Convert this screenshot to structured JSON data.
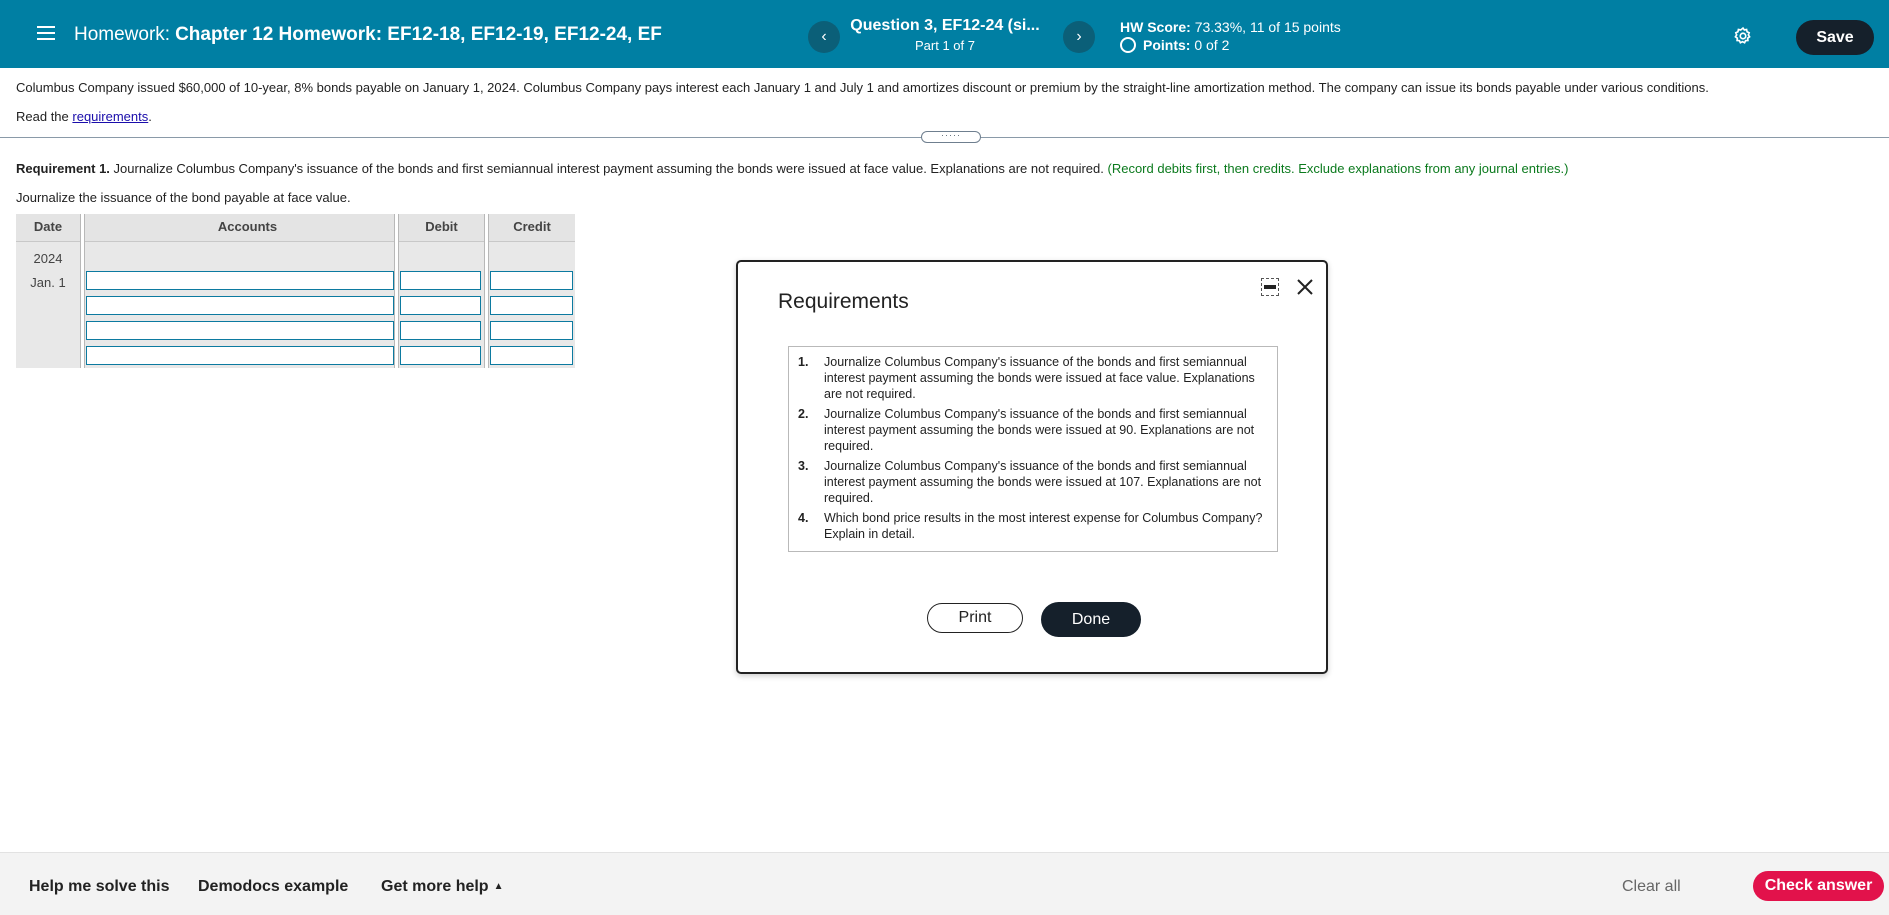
{
  "header": {
    "homework_label": "Homework:",
    "homework_name": "Chapter 12 Homework: EF12-18, EF12-19, EF12-24, EF",
    "prev_icon": "‹",
    "next_icon": "›",
    "question_title": "Question 3, EF12-24 (si...",
    "question_part": "Part 1 of 7",
    "hw_score_label": "HW Score:",
    "hw_score_value": "73.33%, 11 of 15 points",
    "points_label": "Points:",
    "points_value": "0 of 2",
    "save_label": "Save",
    "icons": [
      "menu-icon",
      "chevron-left-icon",
      "chevron-right-icon",
      "gear-icon"
    ],
    "accent_color": "#007fa3"
  },
  "problem": {
    "statement": "Columbus Company issued $60,000 of 10-year, 8% bonds payable on January 1, 2024. Columbus Company pays interest each January 1 and July 1 and amortizes discount or premium by the straight-line amortization method. The company can issue its bonds payable under various conditions.",
    "read_prefix": "Read the",
    "read_link": "requirements",
    "read_suffix": ".",
    "drag_handle": "·····"
  },
  "requirement1": {
    "label": "Requirement 1.",
    "text": "Journalize Columbus Company's issuance of the bonds and first semiannual interest payment assuming the bonds were issued at face value. Explanations are not required.",
    "instruction": "(Record debits first, then credits. Exclude explanations from any journal entries.)",
    "subtitle": "Journalize the issuance of the bond payable at face value."
  },
  "journal": {
    "headers": [
      "Date",
      "Accounts",
      "Debit",
      "Credit"
    ],
    "year": "2024",
    "date": "Jan. 1",
    "rows": [
      {
        "account": "",
        "debit": "",
        "credit": ""
      },
      {
        "account": "",
        "debit": "",
        "credit": ""
      },
      {
        "account": "",
        "debit": "",
        "credit": ""
      },
      {
        "account": "",
        "debit": "",
        "credit": ""
      }
    ]
  },
  "modal": {
    "title": "Requirements",
    "items": [
      {
        "num": "1.",
        "text": "Journalize Columbus Company's issuance of the bonds and first semiannual interest payment assuming the bonds were issued at face value. Explanations are not required."
      },
      {
        "num": "2.",
        "text": "Journalize Columbus Company's issuance of the bonds and first semiannual interest payment assuming the bonds were issued at 90. Explanations are not required."
      },
      {
        "num": "3.",
        "text": "Journalize Columbus Company's issuance of the bonds and first semiannual interest payment assuming the bonds were issued at 107. Explanations are not required."
      },
      {
        "num": "4.",
        "text": "Which bond price results in the most interest expense for Columbus Company? Explain in detail."
      }
    ],
    "print_label": "Print",
    "done_label": "Done",
    "icons": [
      "minimize-icon",
      "close-icon"
    ]
  },
  "footer": {
    "help_label": "Help me solve this",
    "demodocs_label": "Demodocs example",
    "more_help_label": "Get more help",
    "more_help_caret": "▲",
    "clear_label": "Clear all",
    "check_label": "Check answer",
    "check_color": "#e2124b"
  }
}
